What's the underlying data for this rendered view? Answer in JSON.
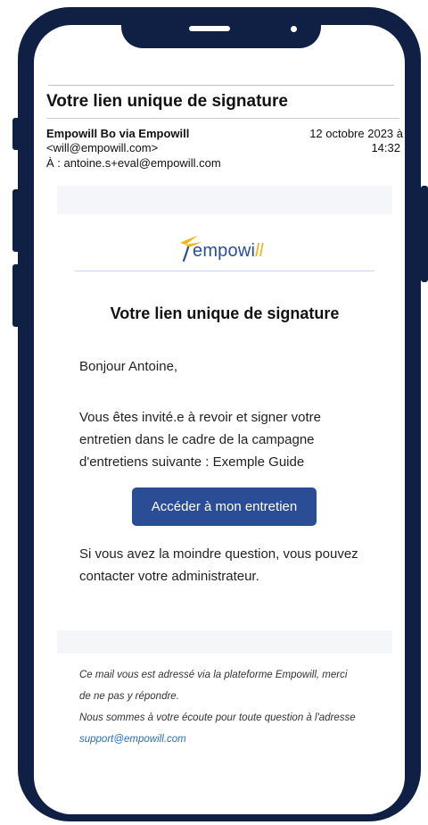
{
  "email": {
    "subject": "Votre lien unique de signature",
    "sender_name": "Empowill Bo via Empowill",
    "sender_email": "<will@empowill.com>",
    "recipient": "À : antoine.s+eval@empowill.com",
    "date": "12 octobre 2023 à",
    "time": "14:32"
  },
  "brand": {
    "logo_main": "empowi",
    "logo_accent": "ll",
    "primary_color": "#2a4d95",
    "accent_color": "#f0b41c",
    "frame_color": "#0f2044"
  },
  "body": {
    "title": "Votre lien unique de signature",
    "greeting": "Bonjour Antoine,",
    "invitation": "Vous êtes invité.e à revoir et signer votre entretien dans le cadre de la campagne d'entretiens suivante : Exemple Guide",
    "cta_label": "Accéder à mon entretien",
    "question": "Si vous avez la moindre question, vous pouvez contacter votre administrateur."
  },
  "footer": {
    "line1": "Ce mail vous est adressé via la plateforme Empowill, merci",
    "line2": "de ne pas y répondre.",
    "line3": "Nous sommes à votre écoute pour toute question à l'adresse",
    "support_link": "support@empowill.com"
  }
}
